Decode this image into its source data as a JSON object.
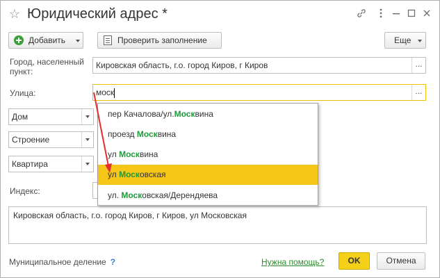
{
  "window": {
    "title": "Юридический адрес *"
  },
  "titlebar_icons": [
    "star-icon",
    "link-icon",
    "more-icon",
    "minimize-icon",
    "maximize-icon",
    "close-icon"
  ],
  "toolbar": {
    "add_label": "Добавить",
    "check_label": "Проверить заполнение",
    "more_label": "Еще"
  },
  "city": {
    "label_line1": "Город, населенный",
    "label_line2": "пункт:",
    "value": "Кировская область, г.о. город Киров, г Киров",
    "select_label": "..."
  },
  "street": {
    "label": "Улица:",
    "value": "моск",
    "select_label": "..."
  },
  "combos": [
    {
      "value": "Дом"
    },
    {
      "value": "Строение"
    },
    {
      "value": "Квартира"
    }
  ],
  "index": {
    "label": "Индекс:"
  },
  "suggestions": [
    {
      "before": "пер Качалова/ул.",
      "match": "Моск",
      "after": "вина",
      "selected": false
    },
    {
      "before": "проезд ",
      "match": "Моск",
      "after": "вина",
      "selected": false
    },
    {
      "before": "ул ",
      "match": "Моск",
      "after": "вина",
      "selected": false
    },
    {
      "before": "ул ",
      "match": "Моск",
      "after": "овская",
      "selected": true
    },
    {
      "before": "ул. ",
      "match": "Моск",
      "after": "овская/Дерендяева",
      "selected": false
    }
  ],
  "full_address": "Кировская область, г.о. город Киров, г Киров, ул Московская",
  "footer": {
    "municipal_label": "Муниципальное деление",
    "question_mark": "?",
    "help_link": "Нужна помощь?",
    "ok_label": "OK",
    "cancel_label": "Отмена"
  },
  "colors": {
    "accent_yellow": "#f5c618",
    "match_green": "#1f9a3a",
    "arrow_red": "#e03030"
  }
}
